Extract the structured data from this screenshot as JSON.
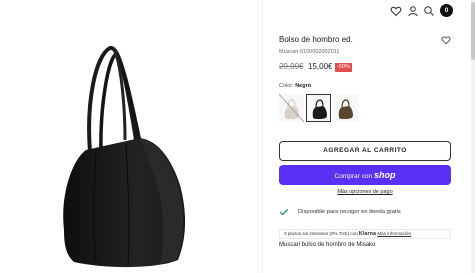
{
  "product": {
    "title": "Bolso de hombro ed.",
    "sku": "Muscari-5100002002011",
    "price_old": "29,99€",
    "price_new": "15,00€",
    "discount": "-50%",
    "color_label": "Color:",
    "color_value": "Negro",
    "swatches": [
      {
        "name": "Beige",
        "color": "#d8d2c6",
        "available": false
      },
      {
        "name": "Negro",
        "color": "#1b1b1b",
        "available": true,
        "selected": true
      },
      {
        "name": "Marrón",
        "color": "#5a4530",
        "available": true
      }
    ],
    "add_to_cart": "AGREGAR AL CARRITO",
    "shop_pay_prefix": "Comprar con",
    "shop_pay_brand": "shop",
    "more_payment": "Más opciones de pago",
    "availability": "Disponible para recoger en tienda gratis",
    "klarna_text": "3 plazos sin intereses (0% TAE) con",
    "klarna_brand": "Klarna",
    "klarna_link": "Más información",
    "description": "Muscari bolso de hombro de Misako"
  },
  "header": {
    "cart_count": "0",
    "icons": [
      "heart-icon",
      "user-icon",
      "search-icon",
      "cart-icon"
    ]
  },
  "colors": {
    "shop_pay": "#5a31f4",
    "discount": "#e24d4d",
    "check": "#2a9d6b"
  }
}
